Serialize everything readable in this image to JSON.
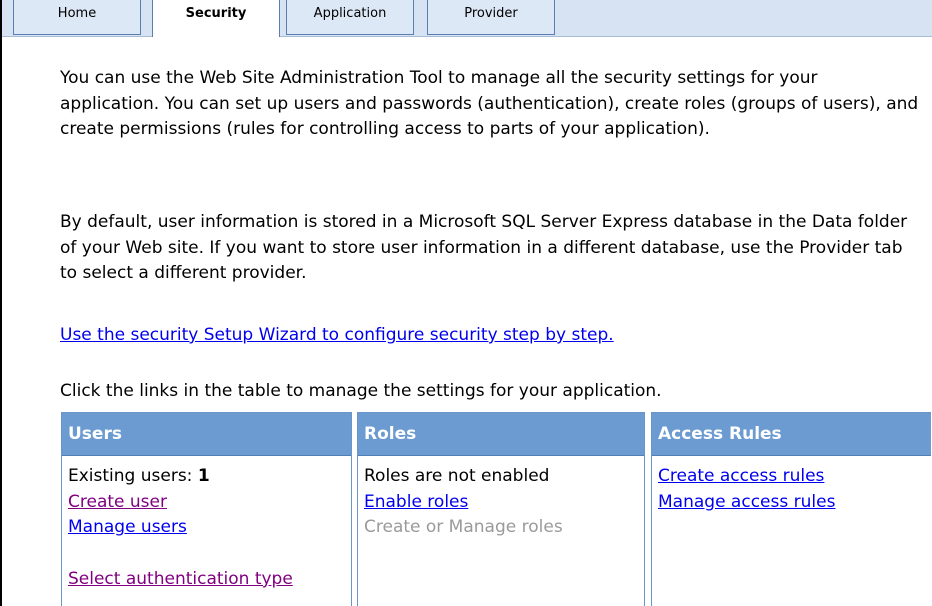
{
  "tabs": [
    {
      "label": "Home",
      "active": false
    },
    {
      "label": "Security",
      "active": true
    },
    {
      "label": "Application",
      "active": false
    },
    {
      "label": "Provider",
      "active": false
    }
  ],
  "content": {
    "paragraph1": "You can use the Web Site Administration Tool to manage all the security settings for your application. You can set up users and passwords (authentication), create roles (groups of users), and create permissions (rules for controlling access to parts of your application).",
    "paragraph2": "By default, user information is stored in a Microsoft SQL Server Express database in the Data folder of your Web site. If you want to store user information in a different database, use the Provider tab to select a different provider.",
    "wizard_link": "Use the security Setup Wizard to configure security step by step.",
    "table_intro": "Click the links in the table to manage the settings for your application."
  },
  "users": {
    "header": "Users",
    "existing_label": "Existing users: ",
    "existing_count": "1",
    "create_user": "Create user",
    "manage_users": "Manage users",
    "select_auth": "Select authentication type"
  },
  "roles": {
    "header": "Roles",
    "status": "Roles are not enabled",
    "enable_roles": "Enable roles",
    "create_manage": "Create or Manage roles"
  },
  "access_rules": {
    "header": "Access Rules",
    "create_rules": "Create access rules",
    "manage_rules": "Manage access rules"
  },
  "colors": {
    "tab_background": "#dde8f6",
    "header_blue": "#6b9bd0",
    "link": "#0000ee",
    "visited_link": "#800080",
    "disabled": "#9a9a9a"
  }
}
